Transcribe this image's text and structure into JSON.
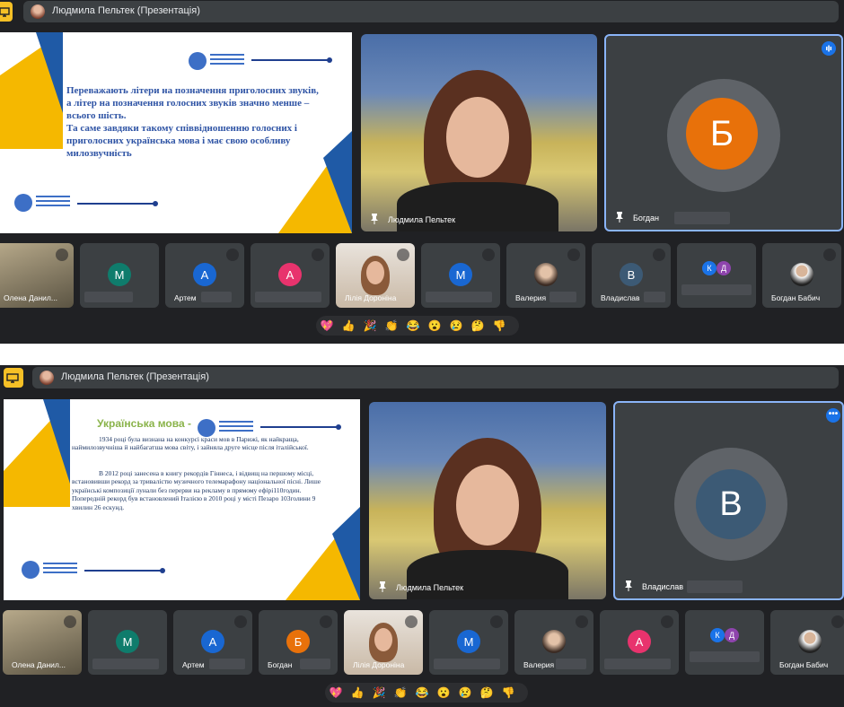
{
  "window": {
    "presenter_label": "Людмила Пельтек (Презентація)"
  },
  "colors": {
    "bg": "#202124",
    "tile": "#3c4043",
    "accent": "#8ab4f8",
    "flag_yellow": "#f5b800",
    "flag_blue": "#1f5aa6"
  },
  "top": {
    "slide": {
      "text_line1": "Переважають літери на позначення приголосних звуків,",
      "text_line2": "а літер на позначення голосних звуків значно менше –",
      "text_line3": "всього шість.",
      "text_line4": "Та саме завдяки такому співвідношенню голосних і",
      "text_line5": "приголосних українська мова і має свою особливу",
      "text_line6": "милозвучність"
    },
    "speaker_name": "Людмила Пельтек",
    "featured": {
      "initial": "Б",
      "name": "Богдан",
      "avatar_color": "#e8710a"
    },
    "participants": [
      {
        "name": "Олена Данил...",
        "initial": "",
        "color": ""
      },
      {
        "name": "",
        "initial": "М",
        "color": "#0f7c6c"
      },
      {
        "name": "Артем",
        "initial": "А",
        "color": "#1967d2"
      },
      {
        "name": "",
        "initial": "А",
        "color": "#e8336d"
      },
      {
        "name": "Лілія Доронiна",
        "initial": "",
        "color": ""
      },
      {
        "name": "",
        "initial": "М",
        "color": "#1967d2"
      },
      {
        "name": "Валерия",
        "initial": "",
        "color": ""
      },
      {
        "name": "Владислав",
        "initial": "В",
        "color": "#3c5a75"
      },
      {
        "name": "",
        "initial": "К Д",
        "color": "#1a73e8"
      },
      {
        "name": "Богдан Бабич",
        "initial": "",
        "color": ""
      }
    ]
  },
  "bottom": {
    "slide": {
      "heading": "Українська мова -",
      "para1": "1934 році була визнана на конкурсі краси мов в Парижі, як найкраща, наймилозвучніша й найбагатша мова світу, і зайняла друге місце після італійської.",
      "para2": "В 2012 році занесена в книгу рекордів Гіннеса, і відвищ на першому місці, встановивши рекорд за тривалістю музичного телемарафону національної пісні. Лише українські композиції лунали без перерви на рекламу в прямому ефірі110годин. Попередній рекорд був встановлений Італією в 2010 році у місті Пезаро 103голини 9 хвилин 26 ескунд."
    },
    "speaker_name": "Людмила Пельтек",
    "featured": {
      "initial": "В",
      "name": "Владислав",
      "avatar_color": "#3c5a75"
    },
    "participants": [
      {
        "name": "Олена Данил...",
        "initial": "",
        "color": ""
      },
      {
        "name": "",
        "initial": "М",
        "color": "#0f7c6c"
      },
      {
        "name": "Артем",
        "initial": "А",
        "color": "#1967d2"
      },
      {
        "name": "Богдан",
        "initial": "Б",
        "color": "#e8710a"
      },
      {
        "name": "Лілія Доронiна",
        "initial": "",
        "color": ""
      },
      {
        "name": "",
        "initial": "М",
        "color": "#1967d2"
      },
      {
        "name": "Валерия",
        "initial": "",
        "color": ""
      },
      {
        "name": "",
        "initial": "А",
        "color": "#e8336d"
      },
      {
        "name": "",
        "initial": "К Д",
        "color": "#1a73e8"
      },
      {
        "name": "Богдан Бабич",
        "initial": "",
        "color": ""
      }
    ]
  },
  "reactions": [
    "💖",
    "👍",
    "🎉",
    "👏",
    "😂",
    "😮",
    "😢",
    "🤔",
    "👎"
  ]
}
